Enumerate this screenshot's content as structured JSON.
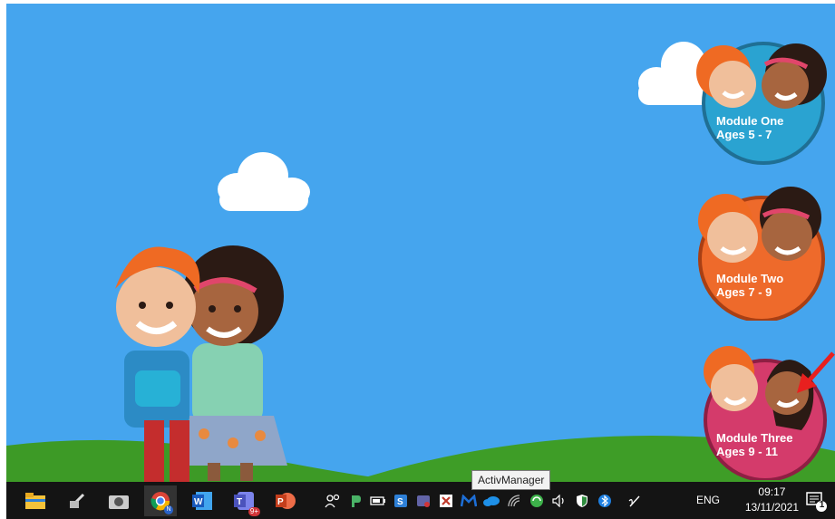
{
  "desktop": {
    "wallpaper": {
      "sky_color": "#45a5ee",
      "grass_color": "#3d9a26"
    },
    "modules": [
      {
        "title": "Module One",
        "ages": "Ages 5 - 7",
        "color": "#2aa3d1"
      },
      {
        "title": "Module Two",
        "ages": "Ages 7 - 9",
        "color": "#ee6a2b"
      },
      {
        "title": "Module Three",
        "ages": "Ages 9 - 11",
        "color": "#d43b6b"
      }
    ]
  },
  "taskbar": {
    "apps": [
      "file-explorer-icon",
      "snipping-tool-icon",
      "camera-icon",
      "chrome-icon",
      "word-icon",
      "teams-icon",
      "powerpoint-icon"
    ],
    "teams_badge": "9+",
    "tray_icons": [
      "people-icon",
      "pushbullet-icon",
      "battery-icon",
      "sync-icon",
      "teams-tray-icon",
      "close-tray-icon",
      "malwarebytes-icon",
      "onedrive-icon",
      "wifi-icon",
      "green-sync-icon",
      "volume-icon",
      "security-icon",
      "bluetooth-icon",
      "pen-icon"
    ],
    "language": "ENG",
    "time": "09:17",
    "date": "13/11/2021",
    "notification_count": "1"
  },
  "tooltip": {
    "text": "ActivManager"
  }
}
